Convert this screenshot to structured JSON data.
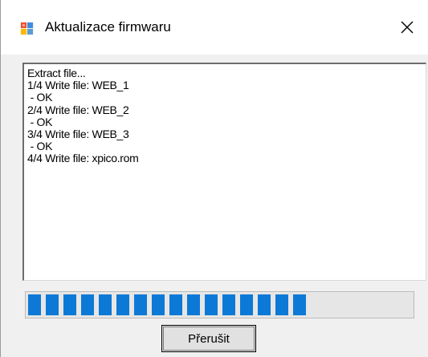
{
  "window": {
    "title": "Aktualizace firmwaru",
    "icon": "app-window-icon",
    "close_icon": "close-icon"
  },
  "log": {
    "lines": [
      "Extract file...",
      "1/4 Write file: WEB_1",
      " - OK",
      "2/4 Write file: WEB_2",
      " - OK",
      "3/4 Write file: WEB_3",
      " - OK",
      "4/4 Write file: xpico.rom"
    ]
  },
  "progress": {
    "value_fraction": 0.74,
    "filled_blocks": 16,
    "color": "#0c79d6"
  },
  "buttons": {
    "cancel_label": "Přerušit"
  }
}
